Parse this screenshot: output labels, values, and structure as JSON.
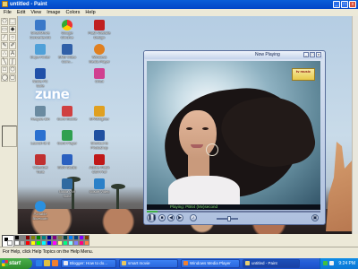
{
  "window": {
    "title": "untitled - Paint"
  },
  "menu": [
    "File",
    "Edit",
    "View",
    "Image",
    "Colors",
    "Help"
  ],
  "desktop_icons": [
    {
      "label": "SmartMovie Converter.lnk",
      "color": "#3a78c8"
    },
    {
      "label": "Dupe Finder",
      "color": "#4fa0d8"
    },
    {
      "label": "Nokia PC Suite",
      "color": "#2050a8"
    },
    {
      "label": "Recycle Bin",
      "color": "#6a8aa0"
    },
    {
      "label": "Launch IE 8",
      "color": "#2a70d0"
    },
    {
      "label": "VideoGet Tools",
      "color": "#c03030"
    },
    {
      "label": "Portable Bluetooth",
      "color": "#2a90e0"
    },
    {
      "label": "Google Chrome",
      "color": "#e05030"
    },
    {
      "label": "SMS Video Conv...",
      "color": "#3060a8"
    },
    {
      "label": "Gomi Mobile",
      "color": "#d04040"
    },
    {
      "label": "Gomi Player",
      "color": "#30a050"
    },
    {
      "label": "MSN Studio",
      "color": "#2a60c0"
    },
    {
      "label": "Nokia OVI Suite",
      "color": "#306aa0"
    },
    {
      "label": "Flash Website Design",
      "color": "#c02020"
    },
    {
      "label": "Windows Media Player",
      "color": "#e08020"
    },
    {
      "label": "Orkut",
      "color": "#d04090"
    },
    {
      "label": "SPAMfighter",
      "color": "#e0a020"
    },
    {
      "label": "Shortcut to Photoshop",
      "color": "#2050a0"
    },
    {
      "label": "Adobe Flash CS4 Prof",
      "color": "#c01818"
    },
    {
      "label": "Xilisoft Video",
      "color": "#2a80c8"
    }
  ],
  "zune_text": "zune",
  "media_player": {
    "title": "Now Playing",
    "status": "Playing: PB64 (Mv)second",
    "progress": 0.06,
    "volume": 0.6,
    "logo_text": "tv music"
  },
  "palette": {
    "colors": [
      "#000000",
      "#808080",
      "#800000",
      "#808000",
      "#008000",
      "#008080",
      "#000080",
      "#800080",
      "#808040",
      "#004040",
      "#0080ff",
      "#004080",
      "#8000ff",
      "#804000",
      "#ffffff",
      "#c0c0c0",
      "#ff0000",
      "#ffff00",
      "#00ff00",
      "#00ffff",
      "#0000ff",
      "#ff00ff",
      "#ffff80",
      "#00ff80",
      "#80ffff",
      "#8080ff",
      "#ff0080",
      "#ff8040"
    ]
  },
  "status_text": "For Help, click Help Topics on the Help Menu.",
  "taskbar": {
    "start_label": "start",
    "tasks": [
      {
        "label": "Blogger: How to do...",
        "active": false
      },
      {
        "label": "smart movie",
        "active": false
      },
      {
        "label": "Windows Media Player",
        "active": false
      },
      {
        "label": "untitled - Paint",
        "active": true
      }
    ],
    "clock": "9:24 PM"
  }
}
